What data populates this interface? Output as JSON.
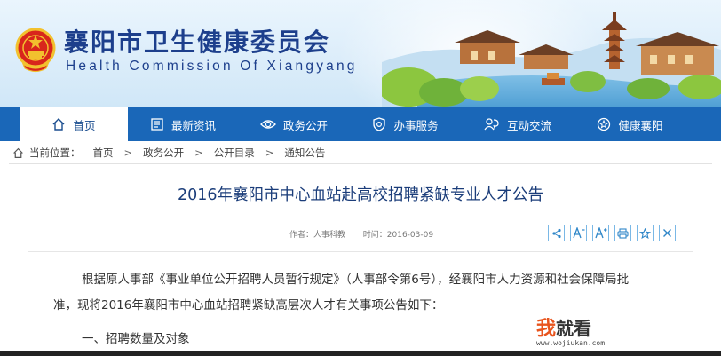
{
  "site": {
    "title": "襄阳市卫生健康委员会",
    "subtitle": "Health Commission Of Xiangyang"
  },
  "nav": {
    "items": [
      {
        "label": "首页",
        "icon": "home-icon",
        "active": true
      },
      {
        "label": "最新资讯",
        "icon": "news-icon"
      },
      {
        "label": "政务公开",
        "icon": "eye-icon"
      },
      {
        "label": "办事服务",
        "icon": "service-icon"
      },
      {
        "label": "互动交流",
        "icon": "chat-icon"
      },
      {
        "label": "健康襄阳",
        "icon": "health-icon"
      }
    ]
  },
  "breadcrumb": {
    "prefix": "当前位置：",
    "items": [
      "首页",
      "政务公开",
      "公开目录",
      "通知公告"
    ],
    "separator": ">"
  },
  "article": {
    "title": "2016年襄阳市中心血站赴高校招聘紧缺专业人才公告",
    "author": "作者：人事科教",
    "date": "时间：2016-03-09",
    "paragraph1": "根据原人事部《事业单位公开招聘人员暂行规定》（人事部令第6号），经襄阳市人力资源和社会保障局批",
    "paragraph2": "准，现将2016年襄阳市中心血站招聘紧缺高层次人才有关事项公告如下：",
    "section1": "一、招聘数量及对象"
  },
  "tools": [
    "share-icon",
    "font-decrease-icon",
    "font-increase-icon",
    "print-icon",
    "favorite-icon",
    "close-icon"
  ],
  "watermark": {
    "text1": "我",
    "text2": "就看",
    "url": "www.wojiukan.com"
  },
  "colors": {
    "nav_bg": "#1a67b8",
    "title_blue": "#1d3f8c",
    "emblem_red": "#d8261c",
    "emblem_gold": "#f2c12e"
  }
}
